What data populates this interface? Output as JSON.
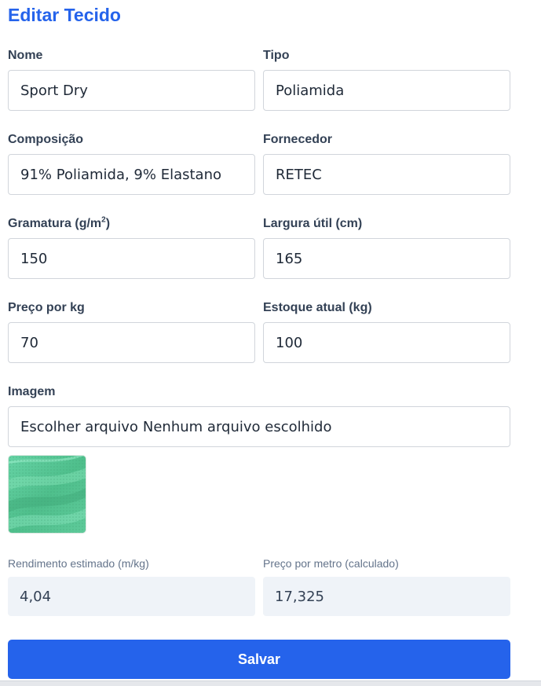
{
  "page": {
    "title": "Editar Tecido"
  },
  "form": {
    "nome": {
      "label": "Nome",
      "value": "Sport Dry"
    },
    "tipo": {
      "label": "Tipo",
      "value": "Poliamida"
    },
    "composicao": {
      "label": "Composição",
      "value": "91% Poliamida, 9% Elastano"
    },
    "fornecedor": {
      "label": "Fornecedor",
      "value": "RETEC"
    },
    "gramatura": {
      "label": "Gramatura (g/m",
      "label_sup": "2",
      "label_end": ")",
      "value": "150"
    },
    "largura": {
      "label": "Largura útil (cm)",
      "value": "165"
    },
    "preco_kg": {
      "label": "Preço por kg",
      "value": "70"
    },
    "estoque": {
      "label": "Estoque atual (kg)",
      "value": "100"
    },
    "imagem": {
      "label": "Imagem",
      "button_text": "Escolher arquivo",
      "status_text": "Nenhum arquivo escolhido",
      "preview_icon": "fabric-preview-image"
    }
  },
  "calculated": {
    "rendimento": {
      "label": "Rendimento estimado (m/kg)",
      "value": "4,04"
    },
    "preco_metro": {
      "label": "Preço por metro (calculado)",
      "value": "17,325"
    }
  },
  "actions": {
    "save_label": "Salvar"
  },
  "colors": {
    "accent": "#2563eb",
    "fabric": "#5cc99a"
  }
}
